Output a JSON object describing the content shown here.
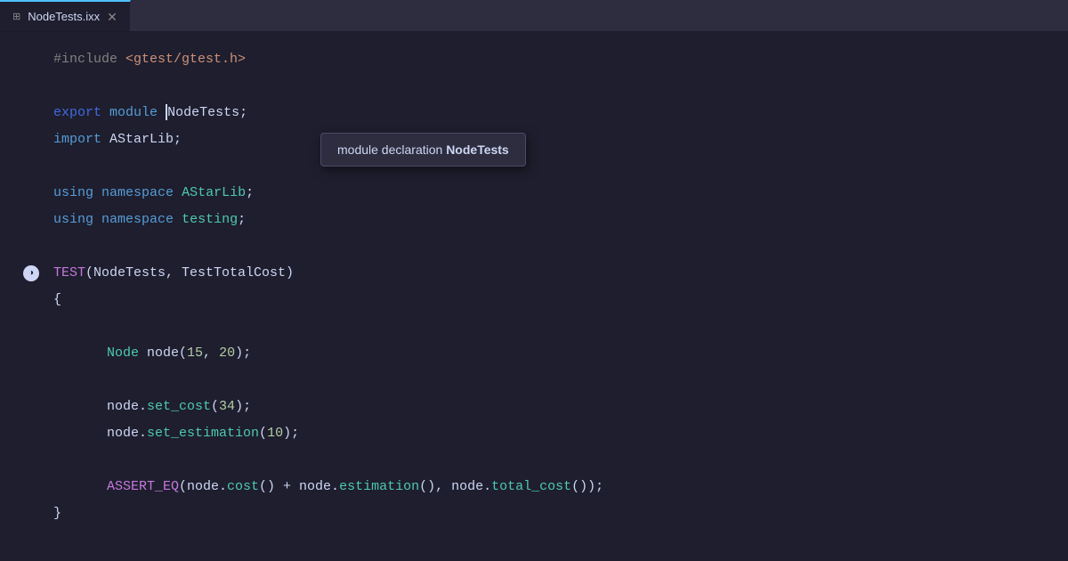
{
  "tab": {
    "filename": "NodeTests.ixx",
    "pin_icon": "⊞",
    "close_icon": "✕"
  },
  "tooltip": {
    "prefix": "module declaration ",
    "bold": "NodeTests"
  },
  "lines": [
    {
      "id": "line-include",
      "gutter": "",
      "segments": [
        {
          "text": "#include ",
          "class": "preprocessor"
        },
        {
          "text": "<gtest/gtest.h>",
          "class": "include-path"
        }
      ]
    },
    {
      "id": "line-empty1",
      "gutter": "",
      "segments": []
    },
    {
      "id": "line-export",
      "gutter": "",
      "segments": [
        {
          "text": "export",
          "class": "kw-export"
        },
        {
          "text": " ",
          "class": "plain"
        },
        {
          "text": "module",
          "class": "kw-blue"
        },
        {
          "text": " NodeTests;",
          "class": "plain"
        }
      ]
    },
    {
      "id": "line-import",
      "gutter": "",
      "segments": [
        {
          "text": "import",
          "class": "kw-blue"
        },
        {
          "text": " AStarLib;",
          "class": "plain"
        }
      ]
    },
    {
      "id": "line-empty2",
      "gutter": "",
      "segments": []
    },
    {
      "id": "line-using1",
      "gutter": "",
      "segments": [
        {
          "text": "using",
          "class": "kw-blue"
        },
        {
          "text": " ",
          "class": "plain"
        },
        {
          "text": "namespace",
          "class": "kw-blue"
        },
        {
          "text": " ",
          "class": "plain"
        },
        {
          "text": "AStarLib",
          "class": "namespace-name"
        },
        {
          "text": ";",
          "class": "plain"
        }
      ]
    },
    {
      "id": "line-using2",
      "gutter": "",
      "segments": [
        {
          "text": "using",
          "class": "kw-blue"
        },
        {
          "text": " ",
          "class": "plain"
        },
        {
          "text": "namespace",
          "class": "kw-blue"
        },
        {
          "text": " ",
          "class": "plain"
        },
        {
          "text": "testing",
          "class": "namespace-name"
        },
        {
          "text": ";",
          "class": "plain"
        }
      ]
    },
    {
      "id": "line-empty3",
      "gutter": "",
      "segments": []
    },
    {
      "id": "line-test-decl",
      "gutter": "breakpoint",
      "segments": [
        {
          "text": "TEST",
          "class": "macro-name"
        },
        {
          "text": "(NodeTests, TestTotalCost)",
          "class": "plain"
        }
      ]
    },
    {
      "id": "line-brace-open",
      "gutter": "",
      "segments": [
        {
          "text": "{",
          "class": "plain"
        }
      ]
    },
    {
      "id": "line-empty4",
      "gutter": "",
      "segments": []
    },
    {
      "id": "line-node-decl",
      "gutter": "",
      "indent": "    ",
      "segments": [
        {
          "text": "Node",
          "class": "namespace-name"
        },
        {
          "text": " node(",
          "class": "plain"
        },
        {
          "text": "15",
          "class": "number-val"
        },
        {
          "text": ", ",
          "class": "plain"
        },
        {
          "text": "20",
          "class": "number-val"
        },
        {
          "text": ");",
          "class": "plain"
        }
      ]
    },
    {
      "id": "line-empty5",
      "gutter": "",
      "segments": []
    },
    {
      "id": "line-set-cost",
      "gutter": "",
      "indent": "    ",
      "segments": [
        {
          "text": "node.",
          "class": "plain"
        },
        {
          "text": "set_cost",
          "class": "method-name"
        },
        {
          "text": "(",
          "class": "plain"
        },
        {
          "text": "34",
          "class": "number-val"
        },
        {
          "text": ");",
          "class": "plain"
        }
      ]
    },
    {
      "id": "line-set-estimation",
      "gutter": "",
      "indent": "    ",
      "segments": [
        {
          "text": "node.",
          "class": "plain"
        },
        {
          "text": "set_estimation",
          "class": "method-name"
        },
        {
          "text": "(",
          "class": "plain"
        },
        {
          "text": "10",
          "class": "number-val"
        },
        {
          "text": ");",
          "class": "plain"
        }
      ]
    },
    {
      "id": "line-empty6",
      "gutter": "",
      "segments": []
    },
    {
      "id": "line-assert",
      "gutter": "",
      "indent": "    ",
      "segments": [
        {
          "text": "ASSERT_EQ",
          "class": "macro-name"
        },
        {
          "text": "(node.",
          "class": "plain"
        },
        {
          "text": "cost",
          "class": "method-name"
        },
        {
          "text": "() + node.",
          "class": "plain"
        },
        {
          "text": "estimation",
          "class": "method-name"
        },
        {
          "text": "(), node.",
          "class": "plain"
        },
        {
          "text": "total_cost",
          "class": "method-name"
        },
        {
          "text": "());",
          "class": "plain"
        }
      ]
    },
    {
      "id": "line-brace-close",
      "gutter": "",
      "segments": [
        {
          "text": "}",
          "class": "plain"
        }
      ]
    }
  ]
}
